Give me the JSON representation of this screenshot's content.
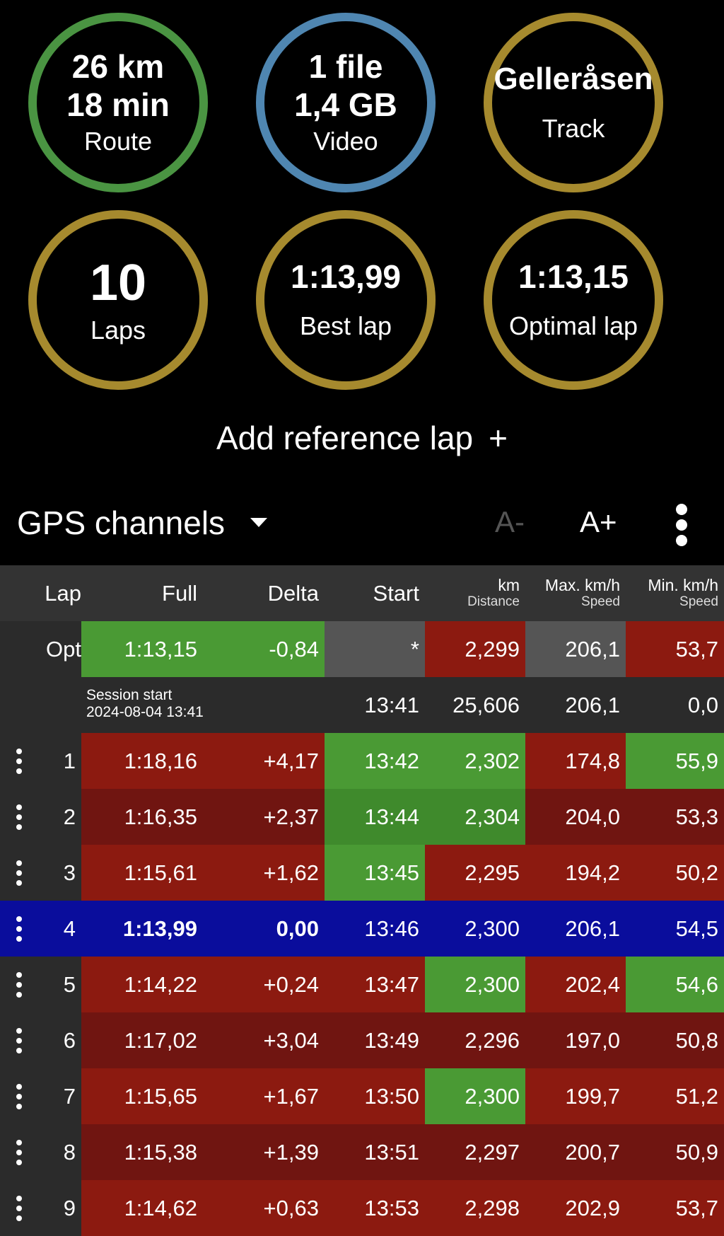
{
  "summary": {
    "route": {
      "line1": "26 km",
      "line2": "18 min",
      "label": "Route"
    },
    "video": {
      "line1": "1 file",
      "line2": "1,4 GB",
      "label": "Video"
    },
    "track": {
      "name": "Gelleråsen",
      "label": "Track"
    },
    "laps": {
      "value": "10",
      "label": "Laps"
    },
    "best_lap": {
      "value": "1:13,99",
      "label": "Best lap"
    },
    "optimal_lap": {
      "value": "1:13,15",
      "label": "Optimal lap"
    }
  },
  "add_reference": {
    "label": "Add reference lap",
    "plus": "+"
  },
  "toolbar": {
    "title": "GPS channels",
    "font_decrease": "A-",
    "font_increase": "A+"
  },
  "table": {
    "headers": {
      "lap": "Lap",
      "full": "Full",
      "delta": "Delta",
      "start": "Start",
      "distance_unit": "km",
      "distance_label": "Distance",
      "max_unit": "Max. km/h",
      "max_label": "Speed",
      "min_unit": "Min. km/h",
      "min_label": "Speed"
    },
    "opt": {
      "lap": "Opt",
      "full": "1:13,15",
      "delta": "-0,84",
      "start": "*",
      "distance": "2,299",
      "max": "206,1",
      "min": "53,7"
    },
    "session": {
      "label": "Session start",
      "datetime": "2024-08-04 13:41",
      "start": "13:41",
      "distance": "25,606",
      "max": "206,1",
      "min": "0,0"
    },
    "rows": [
      {
        "lap": "1",
        "full": "1:18,16",
        "delta": "+4,17",
        "start": "13:42",
        "distance": "2,302",
        "max": "174,8",
        "min": "55,9"
      },
      {
        "lap": "2",
        "full": "1:16,35",
        "delta": "+2,37",
        "start": "13:44",
        "distance": "2,304",
        "max": "204,0",
        "min": "53,3"
      },
      {
        "lap": "3",
        "full": "1:15,61",
        "delta": "+1,62",
        "start": "13:45",
        "distance": "2,295",
        "max": "194,2",
        "min": "50,2"
      },
      {
        "lap": "4",
        "full": "1:13,99",
        "delta": "0,00",
        "start": "13:46",
        "distance": "2,300",
        "max": "206,1",
        "min": "54,5"
      },
      {
        "lap": "5",
        "full": "1:14,22",
        "delta": "+0,24",
        "start": "13:47",
        "distance": "2,300",
        "max": "202,4",
        "min": "54,6"
      },
      {
        "lap": "6",
        "full": "1:17,02",
        "delta": "+3,04",
        "start": "13:49",
        "distance": "2,296",
        "max": "197,0",
        "min": "50,8"
      },
      {
        "lap": "7",
        "full": "1:15,65",
        "delta": "+1,67",
        "start": "13:50",
        "distance": "2,300",
        "max": "199,7",
        "min": "51,2"
      },
      {
        "lap": "8",
        "full": "1:15,38",
        "delta": "+1,39",
        "start": "13:51",
        "distance": "2,297",
        "max": "200,7",
        "min": "50,9"
      },
      {
        "lap": "9",
        "full": "1:14,62",
        "delta": "+0,63",
        "start": "13:53",
        "distance": "2,298",
        "max": "202,9",
        "min": "53,7"
      }
    ]
  },
  "colors": {
    "green_ring": "#4a9442",
    "blue_ring": "#4f86b1",
    "gold_ring": "#a68a2e",
    "best": "#4a9a34",
    "worse": "#8c1a10",
    "selected": "#0a0d9c"
  }
}
